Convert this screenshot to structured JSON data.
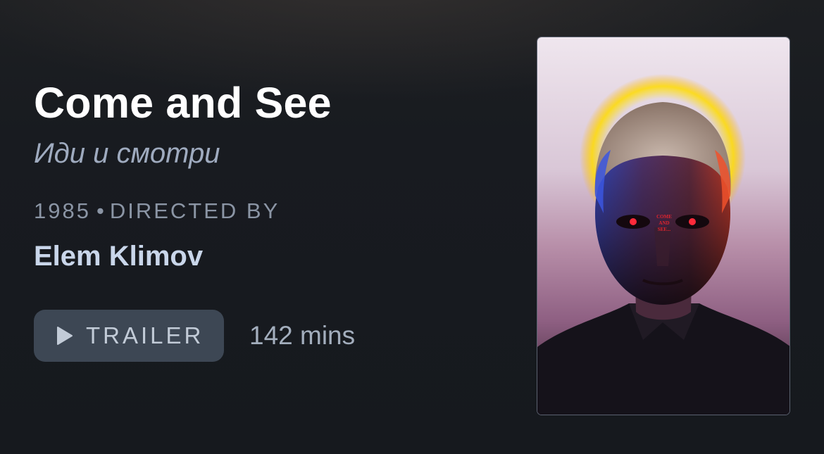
{
  "film": {
    "title": "Come and See",
    "original_title": "Иди и смотри",
    "year": "1985",
    "separator": "•",
    "directed_by_label": "DIRECTED BY",
    "director": "Elem Klimov",
    "runtime": "142 mins"
  },
  "actions": {
    "trailer_label": "TRAILER",
    "trailer_icon": "play-icon"
  },
  "poster": {
    "title_text": [
      "COME",
      "AND",
      "SEE..."
    ]
  },
  "colors": {
    "background": "#16191e",
    "title": "#ffffff",
    "original_title": "#9fabbf",
    "meta": "#8b95a5",
    "director": "#c9d6ea",
    "button_bg": "#3d4754",
    "button_text": "#c2cbd7"
  }
}
